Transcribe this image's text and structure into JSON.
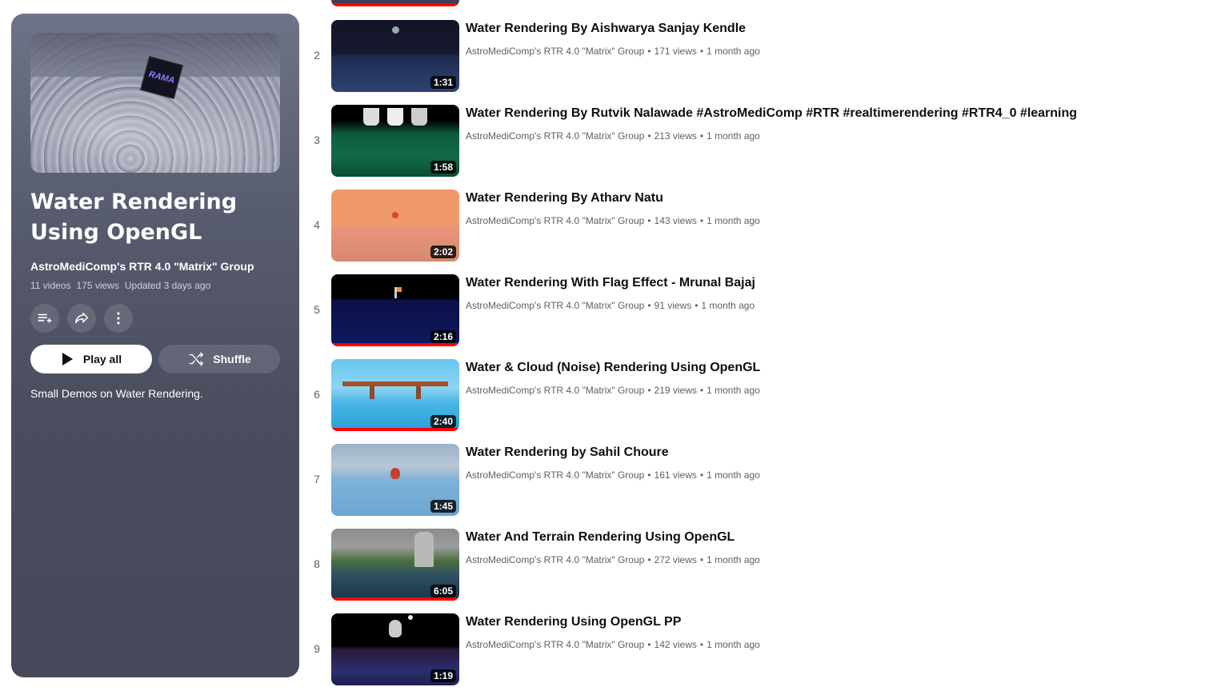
{
  "playlist": {
    "title": "Water Rendering Using OpenGL",
    "owner": "AstroMediComp's RTR 4.0 \"Matrix\" Group",
    "video_count": "11 videos",
    "views": "175 views",
    "updated": "Updated 3 days ago",
    "thumb_text": "RAMA",
    "play_all_label": "Play all",
    "shuffle_label": "Shuffle",
    "description": "Small Demos on Water Rendering.",
    "icons": [
      "save-to-playlist-icon",
      "share-icon",
      "more-vert-icon"
    ]
  },
  "videos": [
    {
      "index": "2",
      "title": "Water Rendering By Aishwarya Sanjay Kendle",
      "channel": "AstroMediComp's RTR 4.0 \"Matrix\" Group",
      "views": "171 views",
      "age": "1 month ago",
      "duration": "1:31",
      "watched": false
    },
    {
      "index": "3",
      "title": "Water Rendering By Rutvik Nalawade #AstroMediComp #RTR #realtimerendering #RTR4_0 #learning",
      "channel": "AstroMediComp's RTR 4.0 \"Matrix\" Group",
      "views": "213 views",
      "age": "1 month ago",
      "duration": "1:58",
      "watched": false
    },
    {
      "index": "4",
      "title": "Water Rendering By Atharv Natu",
      "channel": "AstroMediComp's RTR 4.0 \"Matrix\" Group",
      "views": "143 views",
      "age": "1 month ago",
      "duration": "2:02",
      "watched": false
    },
    {
      "index": "5",
      "title": "Water Rendering With Flag Effect - Mrunal Bajaj",
      "channel": "AstroMediComp's RTR 4.0 \"Matrix\" Group",
      "views": "91 views",
      "age": "1 month ago",
      "duration": "2:16",
      "watched": true
    },
    {
      "index": "6",
      "title": "Water & Cloud (Noise) Rendering Using OpenGL",
      "channel": "AstroMediComp's RTR 4.0 \"Matrix\" Group",
      "views": "219 views",
      "age": "1 month ago",
      "duration": "2:40",
      "watched": true
    },
    {
      "index": "7",
      "title": "Water Rendering by Sahil Choure",
      "channel": "AstroMediComp's RTR 4.0 \"Matrix\" Group",
      "views": "161 views",
      "age": "1 month ago",
      "duration": "1:45",
      "watched": false
    },
    {
      "index": "8",
      "title": "Water And Terrain Rendering Using OpenGL",
      "channel": "AstroMediComp's RTR 4.0 \"Matrix\" Group",
      "views": "272 views",
      "age": "1 month ago",
      "duration": "6:05",
      "watched": true
    },
    {
      "index": "9",
      "title": "Water Rendering Using OpenGL PP",
      "channel": "AstroMediComp's RTR 4.0 \"Matrix\" Group",
      "views": "142 views",
      "age": "1 month ago",
      "duration": "1:19",
      "watched": false
    }
  ],
  "colors": {
    "accent_red": "#ff0000",
    "panel_bg": "#4a4d5e",
    "title_text": "#0f0f0f",
    "meta_text": "#606060"
  }
}
